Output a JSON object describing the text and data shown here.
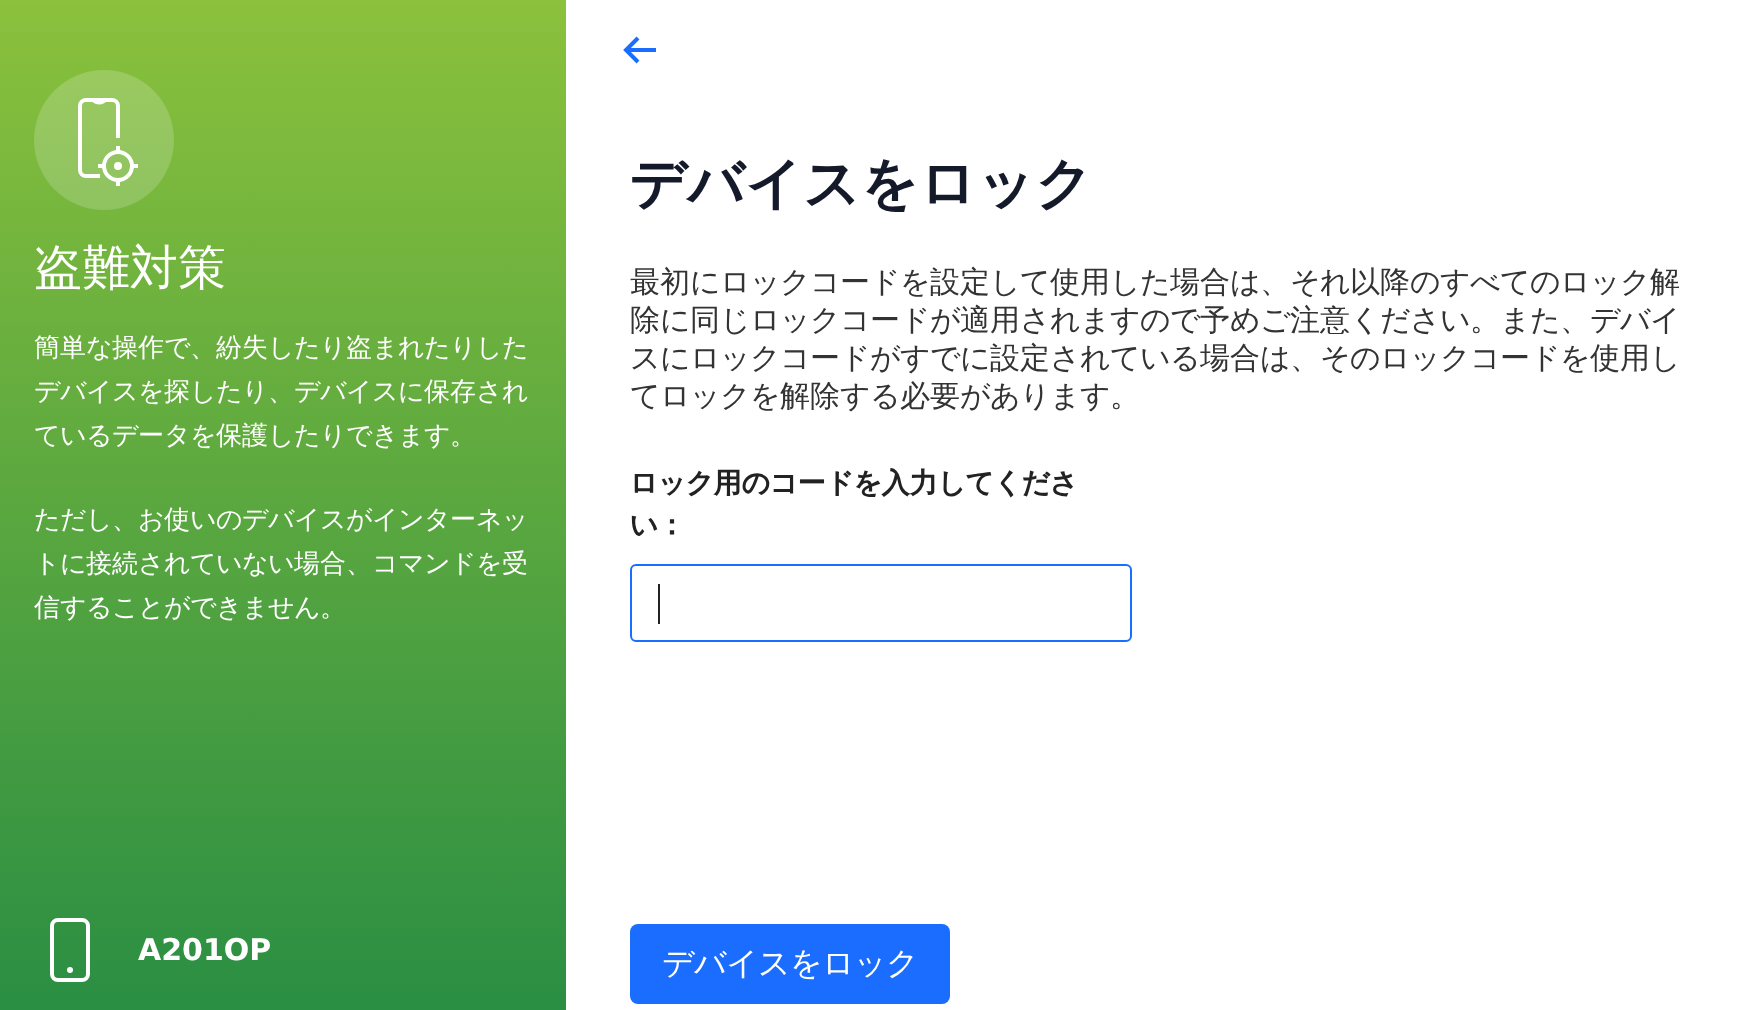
{
  "sidebar": {
    "title": "盗難対策",
    "paragraphs": [
      "簡単な操作で、紛失したり盗まれたりしたデバイスを探したり、デバイスに保存されているデータを保護したりできます。",
      "ただし、お使いのデバイスがインターネットに接続されていない場合、コマンドを受信することができません。"
    ],
    "device_name": "A201OP"
  },
  "main": {
    "title": "デバイスをロック",
    "description": "最初にロックコードを設定して使用した場合は、それ以降のすべてのロック解除に同じロックコードが適用されますので予めご注意ください。また、デバイスにロックコードがすでに設定されている場合は、そのロックコードを使用してロックを解除する必要があります。",
    "field_label": "ロック用のコードを入力してください：",
    "field_focused": true,
    "button": "デバイスをロック"
  }
}
